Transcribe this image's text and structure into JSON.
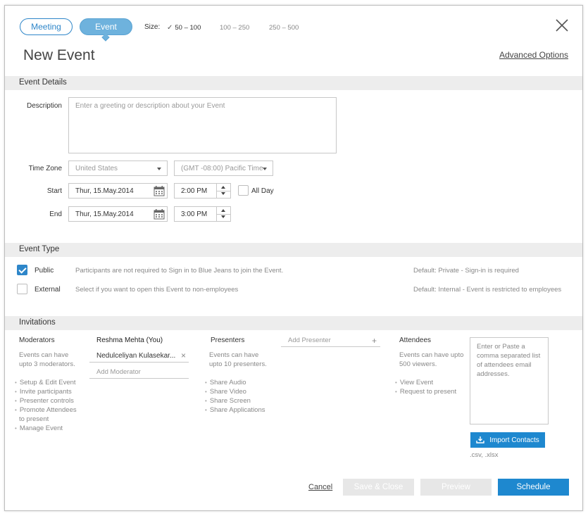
{
  "header": {
    "meeting_label": "Meeting",
    "event_label": "Event",
    "size_label": "Size:",
    "size_options": [
      "50 – 100",
      "100 – 250",
      "250 – 500"
    ],
    "size_check": "✓",
    "title": "New Event",
    "advanced_options": "Advanced Options"
  },
  "event_details": {
    "section_title": "Event Details",
    "description_label": "Description",
    "description_placeholder": "Enter a greeting or description about your Event",
    "timezone_label": "Time Zone",
    "timezone_country": "United States",
    "timezone_zone": "(GMT -08:00) Pacific Time",
    "start_label": "Start",
    "start_date": "Thur, 15.May.2014",
    "start_time": "2:00 PM",
    "all_day_label": "All Day",
    "end_label": "End",
    "end_date": "Thur, 15.May.2014",
    "end_time": "3:00 PM"
  },
  "event_type": {
    "section_title": "Event Type",
    "public_label": "Public",
    "public_checked": true,
    "public_desc": "Participants are not required to Sign in to Blue Jeans to join the Event.",
    "public_default": "Default: Private - Sign-in is required",
    "external_label": "External",
    "external_checked": false,
    "external_desc": "Select if you want to open this Event to non-employees",
    "external_default": "Default: Internal - Event is restricted to employees"
  },
  "invitations": {
    "section_title": "Invitations",
    "moderators": {
      "title": "Moderators",
      "desc_1": "Events can have",
      "desc_2": "upto 3 moderators.",
      "owner": "Reshma Mehta (You)",
      "member": "Nedulceliyan Kulasekar...",
      "remove_icon": "×",
      "add_placeholder": "Add Moderator",
      "perms": [
        "Setup & Edit Event",
        "Invite participants",
        "Presenter controls",
        "Promote Attendees",
        "to present",
        "Manage Event"
      ]
    },
    "presenters": {
      "title": "Presenters",
      "desc_1": "Events can have",
      "desc_2": "upto 10 presenters.",
      "add_placeholder": "Add Presenter",
      "add_icon": "+",
      "perms": [
        "Share Audio",
        "Share Video",
        "Share Screen",
        "Share Applications"
      ]
    },
    "attendees": {
      "title": "Attendees",
      "desc_1": "Events can have upto",
      "desc_2": "500 viewers.",
      "perms": [
        "View Event",
        "Request to present"
      ],
      "textarea_placeholder": "Enter or Paste a comma separated list of attendees email addresses.",
      "import_label": "Import Contacts",
      "file_types": ".csv, .xlsx"
    }
  },
  "footer": {
    "cancel": "Cancel",
    "save_close": "Save & Close",
    "preview": "Preview",
    "schedule": "Schedule"
  },
  "colors": {
    "accent": "#1e88cf",
    "pill_active": "#6eb2dd",
    "section_bg": "#ededed",
    "disabled_btn": "#e7e7e7"
  }
}
